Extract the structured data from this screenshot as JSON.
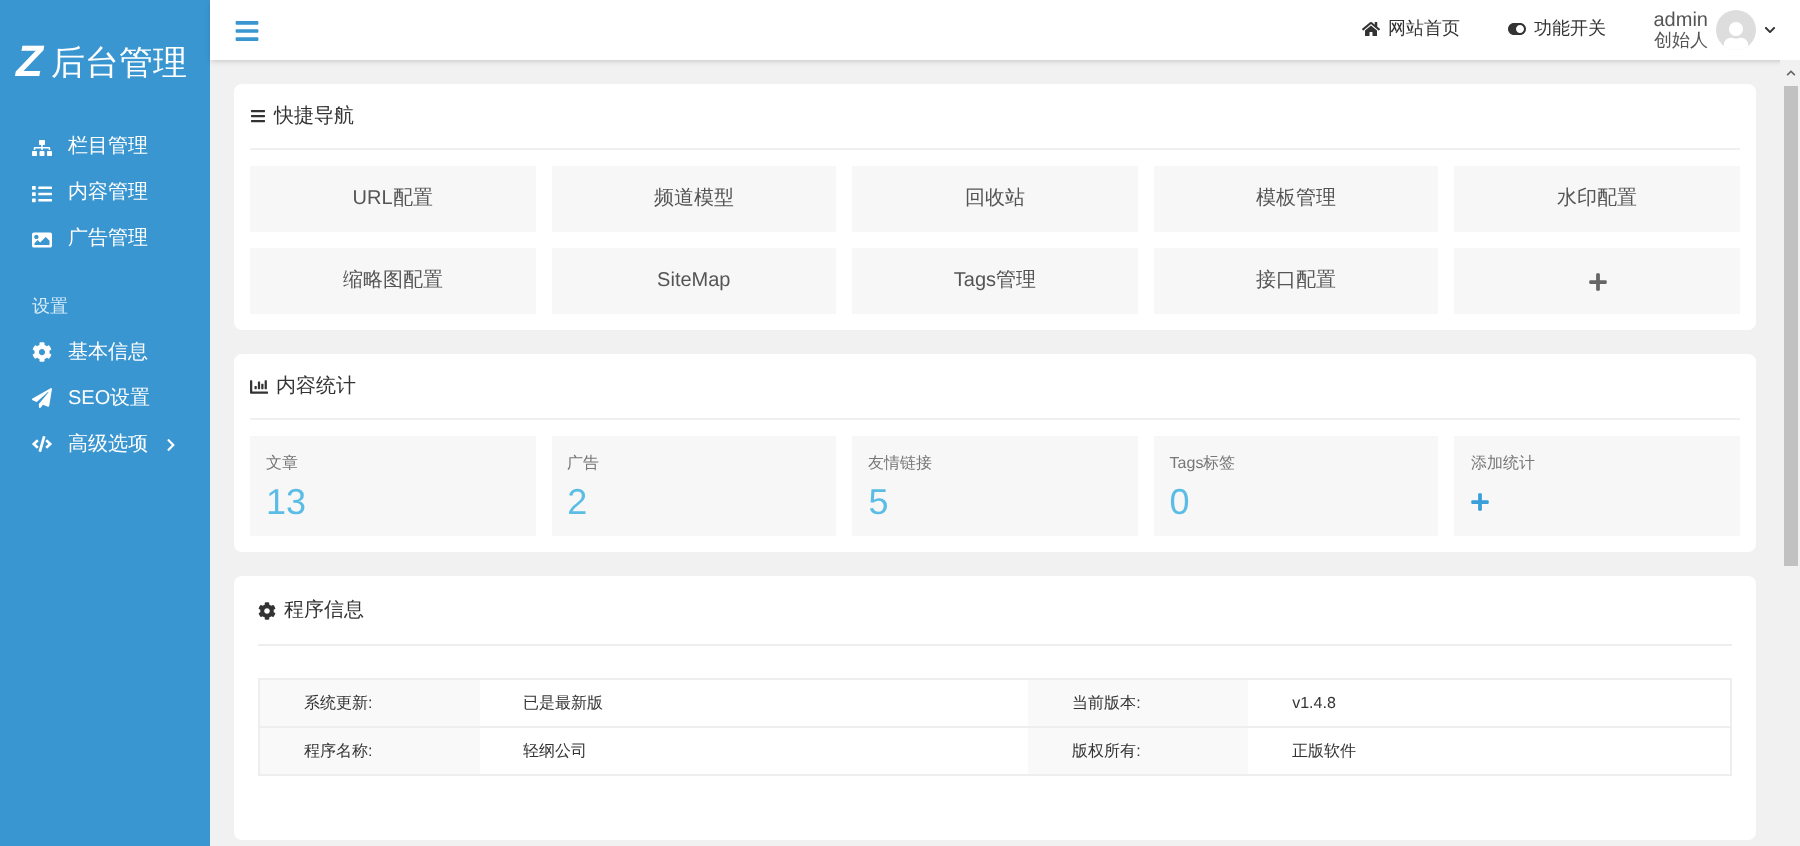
{
  "sidebar": {
    "logo_mark": "Z",
    "logo_text": "后台管理",
    "items": [
      {
        "label": "栏目管理",
        "selected": false
      },
      {
        "label": "内容管理",
        "selected": false
      },
      {
        "label": "广告管理",
        "selected": false
      }
    ],
    "section_title": "设置",
    "settings_items": [
      {
        "label": "基本信息",
        "expandable": false
      },
      {
        "label": "SEO设置",
        "expandable": false
      },
      {
        "label": "高级选项",
        "expandable": true
      }
    ]
  },
  "topbar": {
    "links": [
      {
        "label": "网站首页"
      },
      {
        "label": "功能开关"
      }
    ],
    "user": {
      "name": "admin",
      "role": "创始人"
    }
  },
  "quick_nav": {
    "title": "快捷导航",
    "items": [
      {
        "kind": "text",
        "label": "URL配置"
      },
      {
        "kind": "text",
        "label": "频道模型"
      },
      {
        "kind": "text",
        "label": "回收站"
      },
      {
        "kind": "text",
        "label": "模板管理"
      },
      {
        "kind": "text",
        "label": "水印配置"
      },
      {
        "kind": "text",
        "label": "缩略图配置"
      },
      {
        "kind": "text",
        "label": "SiteMap"
      },
      {
        "kind": "text",
        "label": "Tags管理"
      },
      {
        "kind": "text",
        "label": "接口配置"
      },
      {
        "kind": "add"
      }
    ]
  },
  "stats": {
    "title": "内容统计",
    "items": [
      {
        "kind": "number",
        "label": "文章",
        "value": "13"
      },
      {
        "kind": "number",
        "label": "广告",
        "value": "2"
      },
      {
        "kind": "number",
        "label": "友情链接",
        "value": "5"
      },
      {
        "kind": "number",
        "label": "Tags标签",
        "value": "0"
      },
      {
        "kind": "add",
        "label": "添加统计"
      }
    ]
  },
  "program_info": {
    "title": "程序信息",
    "rows": [
      [
        "系统更新:",
        "已是最新版",
        "当前版本:",
        "v1.4.8"
      ],
      [
        "程序名称:",
        "轻纲公司",
        "版权所有:",
        "正版软件"
      ]
    ]
  }
}
